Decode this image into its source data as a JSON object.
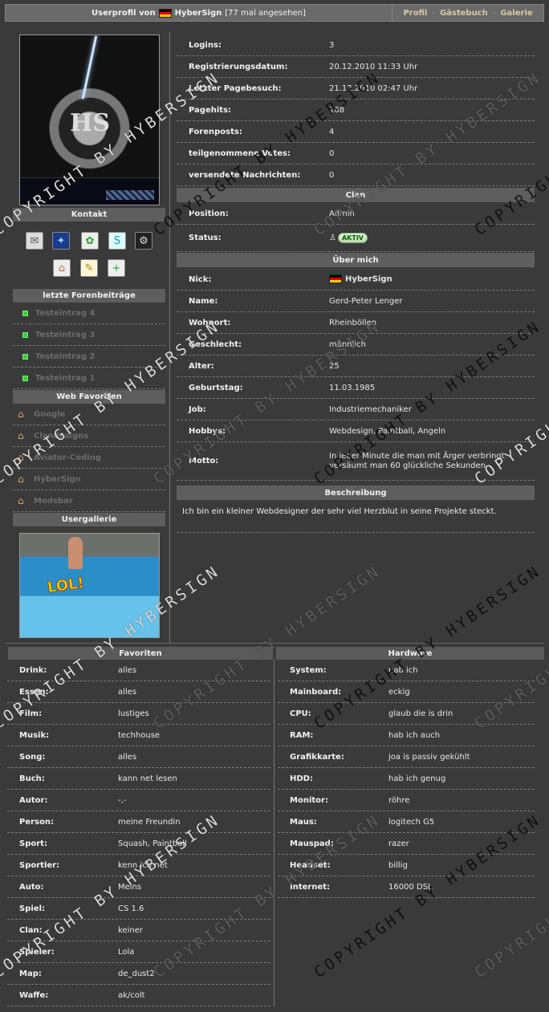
{
  "header": {
    "title_prefix": "Userprofil von",
    "username": "HyberSign",
    "views": "[77 mal angesehen]",
    "nav": [
      "Profil",
      "Gästebuch",
      "Galerie"
    ],
    "nav_sep": "-"
  },
  "left": {
    "kontakt_title": "Kontakt",
    "contact_icons": [
      "mail-icon",
      "msn-icon",
      "icq-icon",
      "skype-icon",
      "steam-icon",
      "homepage-icon",
      "note-icon",
      "add-friend-icon"
    ],
    "forum_title": "letzte Forenbeiträge",
    "forum_posts": [
      "Testeintrag 4",
      "Testeintrag 3",
      "Testeintrag 2",
      "Testeintrag 1"
    ],
    "fav_title": "Web Favoriten",
    "web_favorites": [
      "Google",
      "Clandesigns",
      "Aviator-Coding",
      "HyberSign",
      "Modsbar"
    ],
    "gallery_title": "Usergallerie",
    "gallery_caption": "LOL!"
  },
  "stats": [
    {
      "label": "Logins:",
      "value": "3"
    },
    {
      "label": "Registrierungsdatum:",
      "value": "20.12.2010 11:33 Uhr"
    },
    {
      "label": "Letzter Pagebesuch:",
      "value": "21.12.2010 02:47 Uhr"
    },
    {
      "label": "Pagehits:",
      "value": "168"
    },
    {
      "label": "Forenposts:",
      "value": "4"
    },
    {
      "label": "teilgenommene Votes:",
      "value": "0"
    },
    {
      "label": "versendete Nachrichten:",
      "value": "0"
    }
  ],
  "clan": {
    "title": "Clan",
    "position_label": "Position:",
    "position_value": "Admin",
    "status_label": "Status:",
    "status_value": "AKTIV"
  },
  "about": {
    "title": "Über mich",
    "rows": [
      {
        "label": "Nick:",
        "value": "HyberSign"
      },
      {
        "label": "Name:",
        "value": "Gerd-Peter Lenger"
      },
      {
        "label": "Wohnort:",
        "value": "Rheinböllen"
      },
      {
        "label": "Geschlecht:",
        "value": "männlich"
      },
      {
        "label": "Alter:",
        "value": "25"
      },
      {
        "label": "Geburtstag:",
        "value": "11.03.1985"
      },
      {
        "label": "Job:",
        "value": "Industriemechaniker"
      },
      {
        "label": "Hobbys:",
        "value": "Webdesign, Paintball, Angeln"
      },
      {
        "label": "Motto:",
        "value": "In jeder Minute die man mit Ärger verbringt versäumt man 60 glückliche Sekunden"
      }
    ]
  },
  "description": {
    "title": "Beschreibung",
    "text": "Ich bin ein kleiner Webdesigner der sehr viel Herzblut in seine Projekte steckt."
  },
  "favorites": {
    "title": "Favoriten",
    "rows": [
      {
        "label": "Drink:",
        "value": "alles"
      },
      {
        "label": "Essen:",
        "value": "alles"
      },
      {
        "label": "Film:",
        "value": "lustiges"
      },
      {
        "label": "Musik:",
        "value": "techhouse"
      },
      {
        "label": "Song:",
        "value": "alles"
      },
      {
        "label": "Buch:",
        "value": "kann net lesen"
      },
      {
        "label": "Autor:",
        "value": "-,-"
      },
      {
        "label": "Person:",
        "value": "meine Freundin"
      },
      {
        "label": "Sport:",
        "value": "Squash, Paintball"
      },
      {
        "label": "Sportler:",
        "value": "kenn ich net"
      },
      {
        "label": "Auto:",
        "value": "Meins"
      },
      {
        "label": "Spiel:",
        "value": "CS 1.6"
      },
      {
        "label": "Clan:",
        "value": "keiner"
      },
      {
        "label": "Spieler:",
        "value": "Lola"
      },
      {
        "label": "Map:",
        "value": "de_dust2"
      },
      {
        "label": "Waffe:",
        "value": "ak/colt"
      }
    ]
  },
  "hardware": {
    "title": "Hardware",
    "rows": [
      {
        "label": "System:",
        "value": "hab ich"
      },
      {
        "label": "Mainboard:",
        "value": "eckig"
      },
      {
        "label": "CPU:",
        "value": "glaub die is drin"
      },
      {
        "label": "RAM:",
        "value": "hab ich auch"
      },
      {
        "label": "Grafikkarte:",
        "value": "joa is passiv gekühlt"
      },
      {
        "label": "HDD:",
        "value": "hab ich genug"
      },
      {
        "label": "Monitor:",
        "value": "röhre"
      },
      {
        "label": "Maus:",
        "value": "logitech G5"
      },
      {
        "label": "Mauspad:",
        "value": "razer"
      },
      {
        "label": "Headset:",
        "value": "billig"
      },
      {
        "label": "Internet:",
        "value": "16000 DSL"
      }
    ]
  },
  "watermark": "COPYRIGHT BY HYBERSIGN",
  "colors": {
    "background": "#3a3a3a",
    "header_bar": "#6a6a6a",
    "nav_link": "#d8c8a0",
    "forum_bullet": "#3ec83e"
  }
}
